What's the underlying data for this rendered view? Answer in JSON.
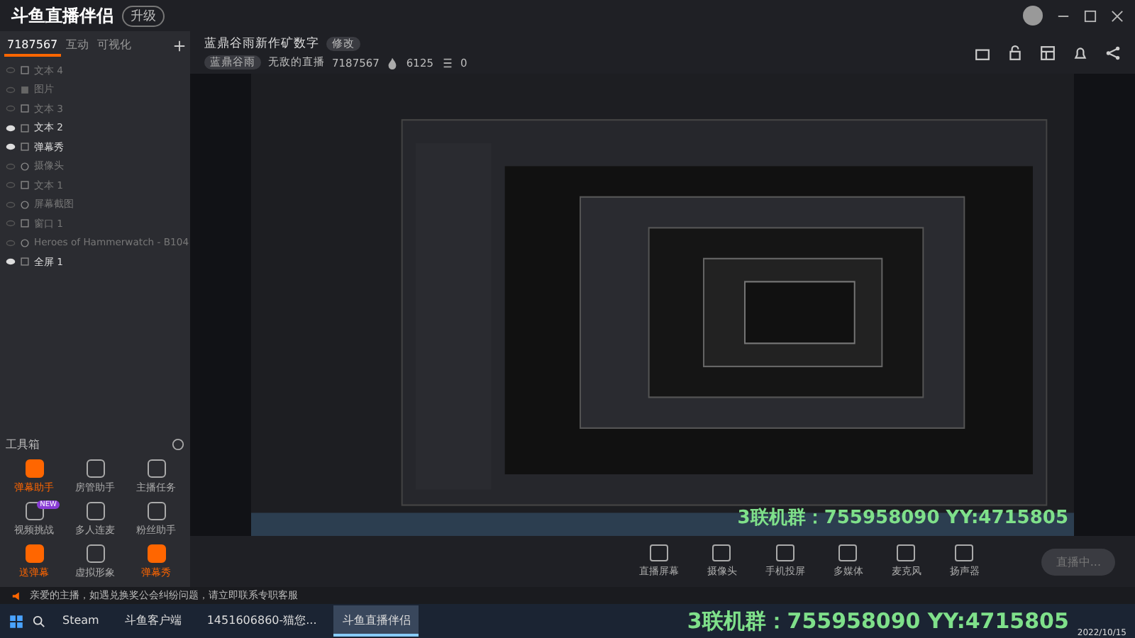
{
  "app": {
    "logo": "斗鱼直播伴侣",
    "version_badge": "升级"
  },
  "sidebar": {
    "tabs": [
      {
        "label": "7187567",
        "selected": true
      },
      {
        "label": "互动",
        "selected": false
      },
      {
        "label": "可视化",
        "selected": false
      }
    ],
    "layers": [
      {
        "name": "文本 4",
        "visible": false,
        "kind": "text"
      },
      {
        "name": "图片",
        "visible": false,
        "kind": "image"
      },
      {
        "name": "文本 3",
        "visible": false,
        "kind": "text"
      },
      {
        "name": "文本 2",
        "visible": true,
        "kind": "text"
      },
      {
        "name": "弹幕秀",
        "visible": true,
        "kind": "widget"
      },
      {
        "name": "摄像头",
        "visible": false,
        "kind": "camera"
      },
      {
        "name": "文本 1",
        "visible": false,
        "kind": "text"
      },
      {
        "name": "屏幕截图",
        "visible": false,
        "kind": "camera"
      },
      {
        "name": "窗口 1",
        "visible": false,
        "kind": "window"
      },
      {
        "name": "Heroes of Hammerwatch - B104",
        "visible": false,
        "kind": "camera"
      },
      {
        "name": "全屏 1",
        "visible": true,
        "kind": "screen"
      }
    ],
    "toolbox_title": "工具箱",
    "tools": [
      {
        "label": "弹幕助手",
        "highlight": true
      },
      {
        "label": "房管助手",
        "highlight": false
      },
      {
        "label": "主播任务",
        "highlight": false
      },
      {
        "label": "视频挑战",
        "highlight": false,
        "badge": "NEW"
      },
      {
        "label": "多人连麦",
        "highlight": false
      },
      {
        "label": "粉丝助手",
        "highlight": false
      },
      {
        "label": "送弹幕",
        "highlight": true
      },
      {
        "label": "虚拟形象",
        "highlight": false
      },
      {
        "label": "弹幕秀",
        "highlight": true
      }
    ]
  },
  "room": {
    "title": "蓝鼎谷雨新作矿数字",
    "edit_badge": "修改",
    "category": "蓝鼎谷雨",
    "cover_label": "无敌的直播",
    "room_number": "7187567",
    "heat": "6125",
    "followers": "0"
  },
  "overlay_texts": [
    "3联机群：755958090  YY:4715805",
    "3联机群：755958090  YY:4715805"
  ],
  "controls": [
    {
      "label": "直播屏幕"
    },
    {
      "label": "摄像头"
    },
    {
      "label": "手机投屏"
    },
    {
      "label": "多媒体"
    },
    {
      "label": "麦克风"
    },
    {
      "label": "扬声器"
    }
  ],
  "live_button": "直播中...",
  "notice": "亲爱的主播，如遇兑换奖公会纠纷问题，请立即联系专职客服",
  "taskbar": {
    "apps": [
      {
        "label": "Steam",
        "selected": false
      },
      {
        "label": "斗鱼客户端",
        "selected": false
      },
      {
        "label": "1451606860-猫您...",
        "selected": false
      },
      {
        "label": "斗鱼直播伴侣",
        "selected": true
      }
    ],
    "date": "2022/10/15"
  }
}
